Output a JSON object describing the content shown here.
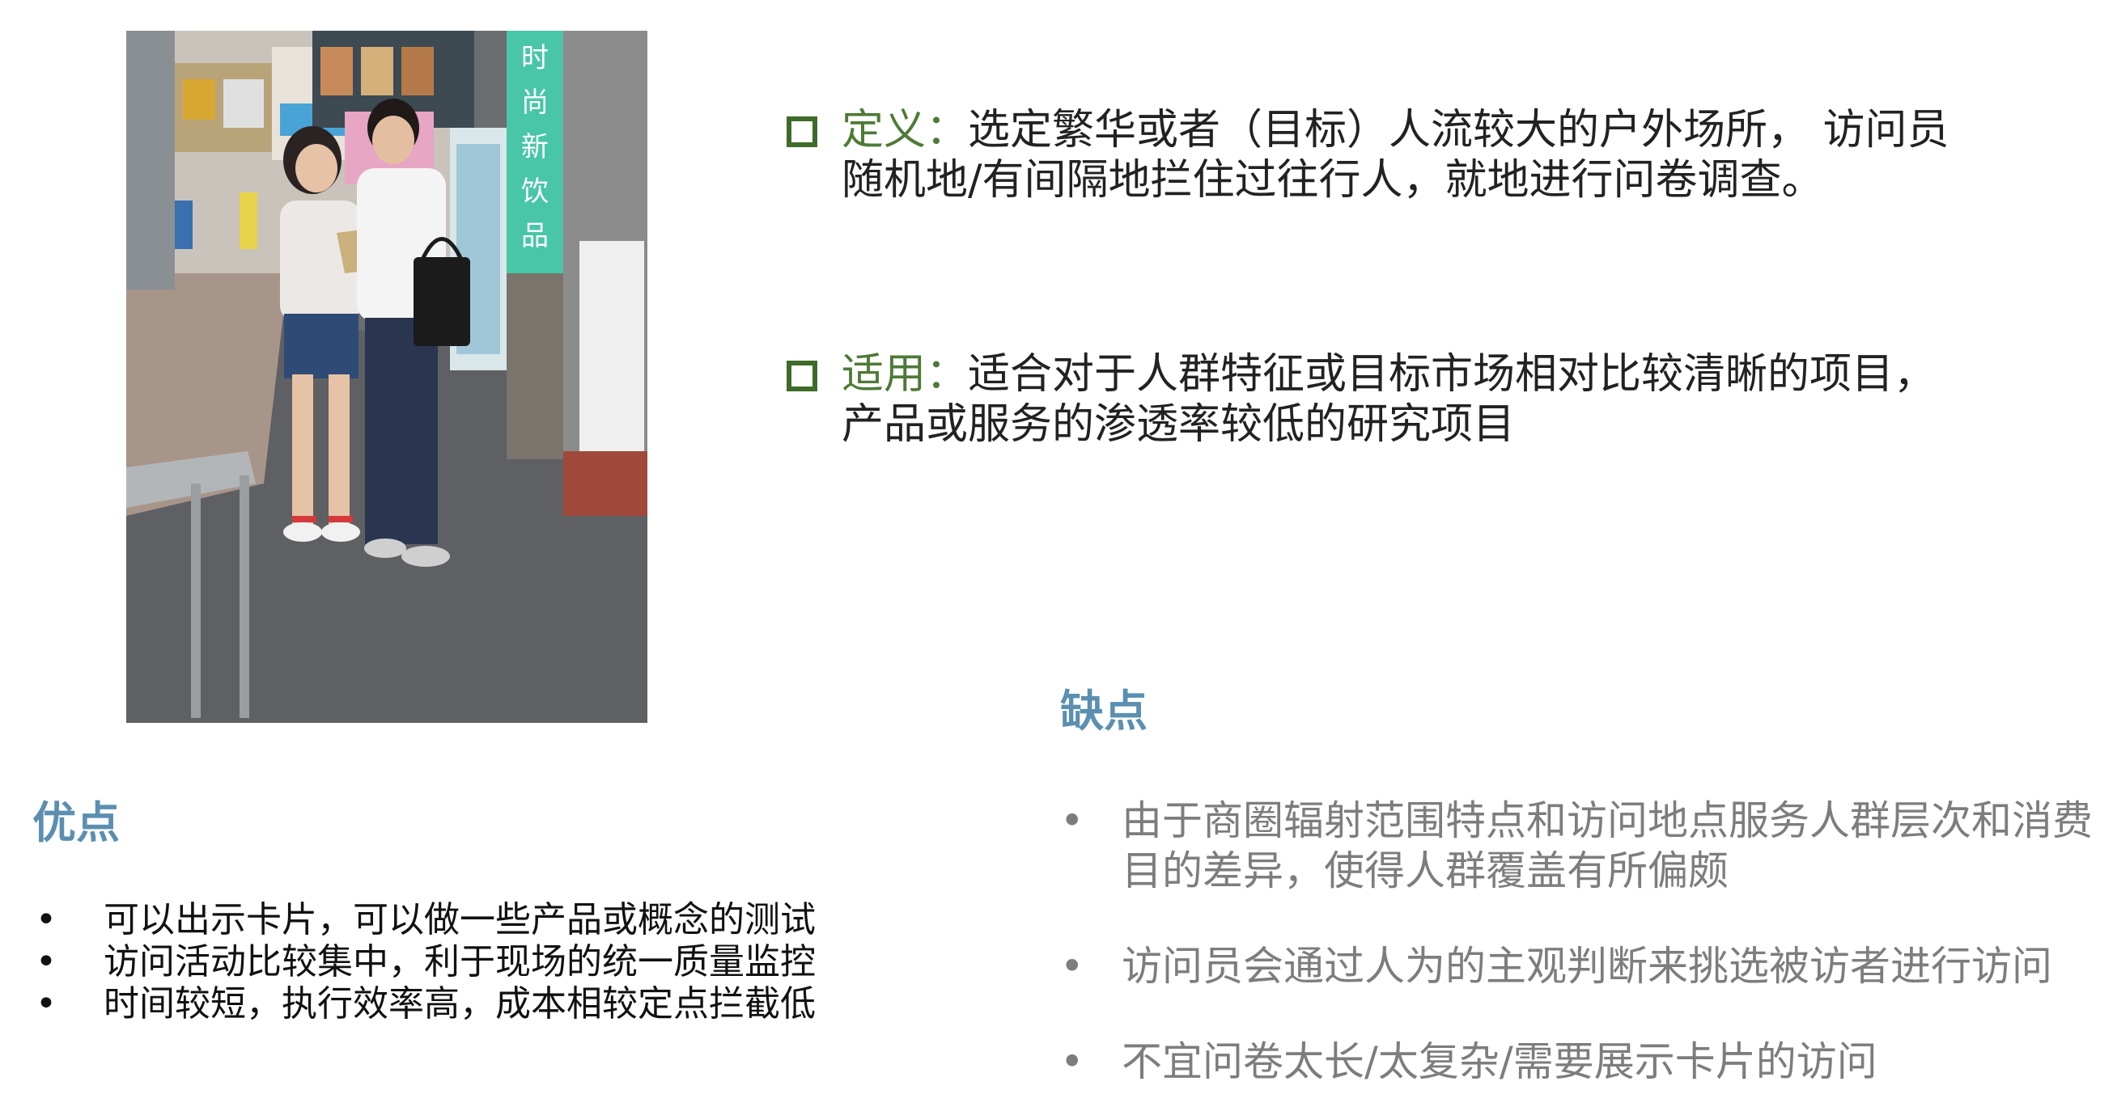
{
  "definition": {
    "label": "定义",
    "colon": "：",
    "text": "选定繁华或者（目标）人流较大的户外场所， 访问员随机地/有间隔地拦住过往行人，就地进行问卷调查。"
  },
  "application": {
    "label": "适用",
    "colon": "：",
    "text": "适合对于人群特征或目标市场相对比较清晰的项目， 产品或服务的渗透率较低的研究项目"
  },
  "pros": {
    "heading": "优点",
    "bullet": "•",
    "items": [
      "可以出示卡片，可以做一些产品或概念的测试",
      "访问活动比较集中，利于现场的统一质量监控",
      "时间较短，执行效率高，成本相较定点拦截低"
    ]
  },
  "cons": {
    "heading": "缺点",
    "bullet": "•",
    "items": [
      "由于商圈辐射范围特点和访问地点服务人群层次和消费目的差异，使得人群覆盖有所偏颇",
      "访问员会通过人为的主观判断来挑选被访者进行访问",
      "不宜问卷太长/太复杂/需要展示卡片的访问"
    ]
  },
  "photo": {
    "sign_text": "时尚新饮品"
  },
  "colors": {
    "label_green": "#4e7a36",
    "bullet_square": "#3f6b2a",
    "heading_blue": "#5b8fb1",
    "cons_gray": "#7d7d7d"
  }
}
